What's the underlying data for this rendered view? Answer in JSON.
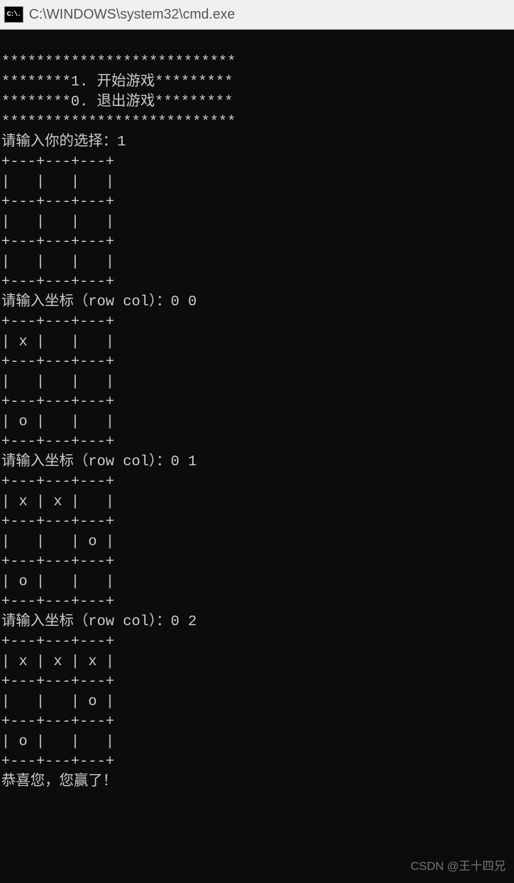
{
  "titlebar": {
    "icon_text": "C:\\.",
    "path": "C:\\WINDOWS\\system32\\cmd.exe"
  },
  "menu": {
    "border": "***************************",
    "opt1": "********1. 开始游戏*********",
    "opt0": "********0. 退出游戏*********"
  },
  "prompts": {
    "choice": "请输入你的选择：",
    "choice_input": "1",
    "coord": "请输入坐标（row col）：",
    "win": "恭喜您，您赢了！"
  },
  "inputs": {
    "c1": "0 0",
    "c2": "0 1",
    "c3": "0 2"
  },
  "board": {
    "hline": "+---+---+---+",
    "empty": "|   |   |   |",
    "r_x__": "| x |   |   |",
    "r_o__": "| o |   |   |",
    "r_xx_": "| x | x |   |",
    "r___o": "|   |   | o |",
    "r_xxx": "| x | x | x |"
  },
  "watermark": "CSDN @王十四兄"
}
